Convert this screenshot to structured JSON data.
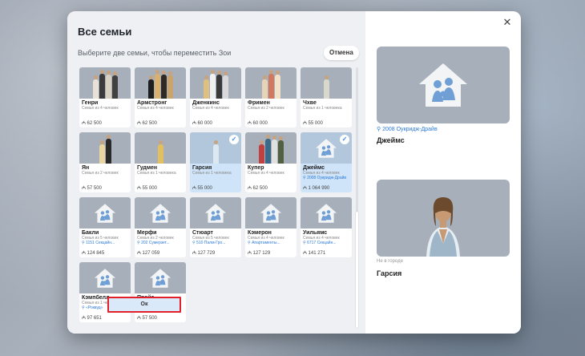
{
  "dialog": {
    "title": "Все семьи",
    "subtitle": "Выберите две семьи, чтобы переместить Зои",
    "cancel_label": "Отмена",
    "close_glyph": "✕",
    "ok_label": "Ок"
  },
  "families": [
    {
      "name": "Генри",
      "sub": "Семья из 4 человек",
      "addr": "",
      "money": "₼ 62 500",
      "selected": false,
      "photo": "people",
      "colors": [
        "#e8e2d6",
        "#3b3b3b",
        "#d8d0c0",
        "#404040"
      ]
    },
    {
      "name": "Армстронг",
      "sub": "Семья из 4 человек",
      "addr": "",
      "money": "₼ 62 500",
      "selected": false,
      "photo": "people",
      "colors": [
        "#1f1f1f",
        "#d8b070",
        "#2f2a26",
        "#caa46a"
      ]
    },
    {
      "name": "Дженкинс",
      "sub": "Семья из 4 человек",
      "addr": "",
      "money": "₼ 60 000",
      "selected": false,
      "photo": "people",
      "colors": [
        "#e0c080",
        "#f0f0f0",
        "#3a3a3a",
        "#d9d9d9"
      ]
    },
    {
      "name": "Фримен",
      "sub": "Семья из 2 человек",
      "addr": "",
      "money": "₼ 60 000",
      "selected": false,
      "photo": "people",
      "colors": [
        "#e6d4b8",
        "#d07860",
        "#f2e0c8"
      ]
    },
    {
      "name": "Чхве",
      "sub": "Семья из 1 человека",
      "addr": "",
      "money": "₼ 55 000",
      "selected": false,
      "photo": "people",
      "colors": [
        "#d8d8cc"
      ]
    },
    {
      "name": "Ян",
      "sub": "Семья из 2 человек",
      "addr": "",
      "money": "₼ 57 500",
      "selected": false,
      "photo": "people",
      "colors": [
        "#e9d6a0",
        "#2a2a2a"
      ]
    },
    {
      "name": "Гудмен",
      "sub": "Семья из 1 человека",
      "addr": "",
      "money": "₼ 55 000",
      "selected": false,
      "photo": "people",
      "colors": [
        "#e2c060"
      ]
    },
    {
      "name": "Гарсия",
      "sub": "Семья из 1 человека",
      "addr": "",
      "money": "₼ 55 000",
      "selected": true,
      "photo": "people",
      "colors": [
        "#dde8f0"
      ]
    },
    {
      "name": "Купер",
      "sub": "Семья из 4 человек",
      "addr": "",
      "money": "₼ 62 500",
      "selected": false,
      "photo": "people",
      "colors": [
        "#c04040",
        "#3a6a8a",
        "#e0e0e0",
        "#506040"
      ]
    },
    {
      "name": "Джеймс",
      "sub": "Семья из 4 человек",
      "addr": "2008 Оукридж-Драйв",
      "money": "₼ 1 064 990",
      "selected": true,
      "photo": "house"
    },
    {
      "name": "Бакли",
      "sub": "Семья из 5 человек",
      "addr": "1151 Секцайн...",
      "money": "₼ 124 845",
      "selected": false,
      "photo": "house"
    },
    {
      "name": "Мерфи",
      "sub": "Семья из 2 человек",
      "addr": "202 Сумерзет...",
      "money": "₼ 127 059",
      "selected": false,
      "photo": "house"
    },
    {
      "name": "Стюарт",
      "sub": "Семья из 5 человек",
      "addr": "510 Палм-Гро...",
      "money": "₼ 127 729",
      "selected": false,
      "photo": "house"
    },
    {
      "name": "Кэмерон",
      "sub": "Семья из 4 человек",
      "addr": "Апартаменты...",
      "money": "₼ 127 129",
      "selected": false,
      "photo": "house"
    },
    {
      "name": "Уильямс",
      "sub": "Семья из 4 человек",
      "addr": "6717 Секцайн...",
      "money": "₼ 141 271",
      "selected": false,
      "photo": "house"
    },
    {
      "name": "Кэмпбелл",
      "sub": "Семья из 1 человека",
      "addr": "«Роквуд»",
      "money": "₼ 97 651",
      "selected": false,
      "photo": "house"
    },
    {
      "name": "Прайс",
      "sub": "Семья из 3 человек",
      "addr": "",
      "money": "₼ 57 500",
      "selected": false,
      "photo": "house"
    }
  ],
  "right_panel": {
    "first": {
      "addr": "2008 Оукридж-Драйв",
      "name": "Джеймс"
    },
    "second": {
      "status": "Не в городе",
      "name": "Гарсия"
    }
  },
  "colors": {
    "accent": "#2c7bd6",
    "highlight": "#e0202a",
    "house": "#6f9fd4"
  }
}
